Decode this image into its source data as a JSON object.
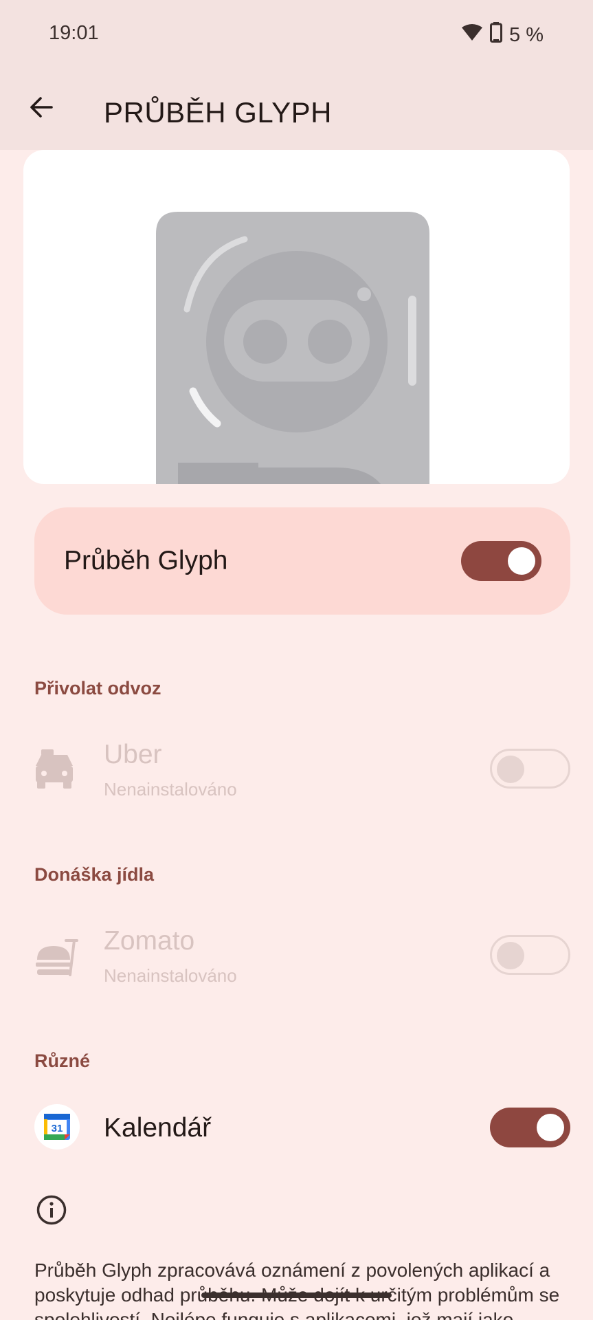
{
  "status_bar": {
    "time": "19:01",
    "battery": "5 %",
    "icons": [
      "wifi-icon",
      "battery-icon"
    ]
  },
  "app_bar": {
    "title": "PRŮBĚH GLYPH",
    "back_icon": "arrow-back-icon"
  },
  "master_toggle": {
    "label": "Průběh Glyph",
    "enabled": true
  },
  "sections": {
    "ride": {
      "header": "Přivolat odvoz",
      "app": {
        "name": "Uber",
        "status": "Nenainstalováno",
        "icon": "taxi-icon",
        "enabled": false
      }
    },
    "food": {
      "header": "Donáška jídla",
      "app": {
        "name": "Zomato",
        "status": "Nenainstalováno",
        "icon": "food-delivery-icon",
        "enabled": false
      }
    },
    "misc": {
      "header": "Různé",
      "app": {
        "name": "Kalendář",
        "icon": "calendar-icon",
        "icon_text": "31",
        "enabled": true
      }
    }
  },
  "info": {
    "icon": "info-icon",
    "text": "Průběh Glyph zpracovává oznámení z povolených aplikací a poskytuje odhad průběhu. Může dojít k určitým problémům se spolehlivostí. Nejlépe funguje s aplikacemi, jež mají jako"
  },
  "colors": {
    "background": "#fdecea",
    "accent": "#8e4740",
    "section_header": "#8b4a41",
    "master_card": "#fdd9d4",
    "disabled_text": "#d8c3c0"
  }
}
